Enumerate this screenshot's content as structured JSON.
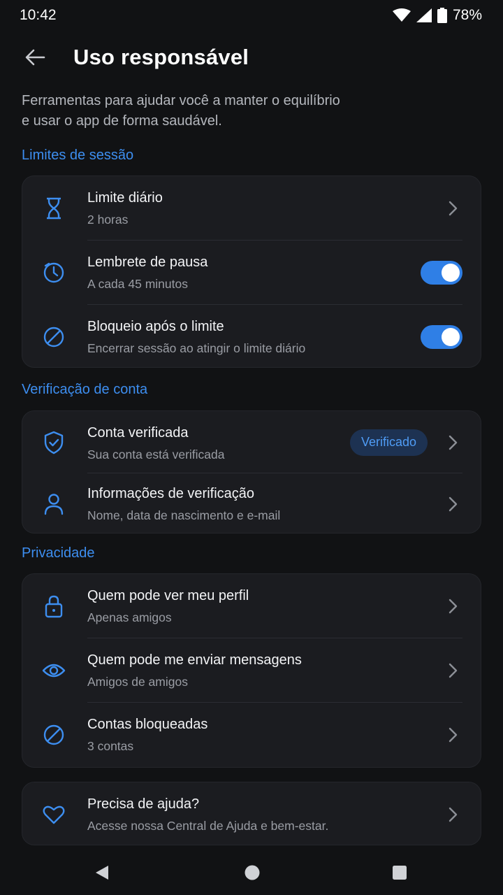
{
  "status_bar": {
    "time": "10:42",
    "battery": "78%"
  },
  "header": {
    "title": "Uso responsável",
    "back_icon": "arrow-left-icon"
  },
  "intro": {
    "line1": "Ferramentas para ajudar você a manter o equilíbrio",
    "line2": "e usar o app de forma saudável."
  },
  "sections": {
    "session": {
      "title": "Limites de sessão",
      "items": [
        {
          "icon": "hourglass-icon",
          "title": "Limite diário",
          "sub": "2 horas"
        },
        {
          "icon": "clock-icon",
          "title": "Lembrete de pausa",
          "sub": "A cada 45 minutos",
          "toggle": true
        },
        {
          "icon": "block-icon",
          "title": "Bloqueio após o limite",
          "sub": "Encerrar sessão ao atingir o limite diário",
          "toggle": true
        }
      ]
    },
    "verification": {
      "title": "Verificação de conta",
      "items": [
        {
          "icon": "shield-check-icon",
          "title": "Conta verificada",
          "sub": "Sua conta está verificada",
          "badge": "Verificado"
        },
        {
          "icon": "person-icon",
          "title": "Informações de verificação",
          "sub": "Nome, data de nascimento e e-mail"
        }
      ]
    },
    "privacy": {
      "title": "Privacidade",
      "items": [
        {
          "icon": "lock-icon",
          "title": "Quem pode ver meu perfil",
          "sub": "Apenas amigos"
        },
        {
          "icon": "eye-icon",
          "title": "Quem pode me enviar mensagens",
          "sub": "Amigos de amigos"
        },
        {
          "icon": "block-icon",
          "title": "Contas bloqueadas",
          "sub": "3 contas"
        }
      ]
    },
    "help": {
      "items": [
        {
          "icon": "heart-icon",
          "title": "Precisa de ajuda?",
          "sub": "Acesse nossa Central de Ajuda e bem-estar."
        }
      ]
    }
  },
  "colors": {
    "accent": "#3d8ef0",
    "background": "#111214",
    "card": "#1b1c20",
    "toggle_on": "#2f7fe6"
  }
}
